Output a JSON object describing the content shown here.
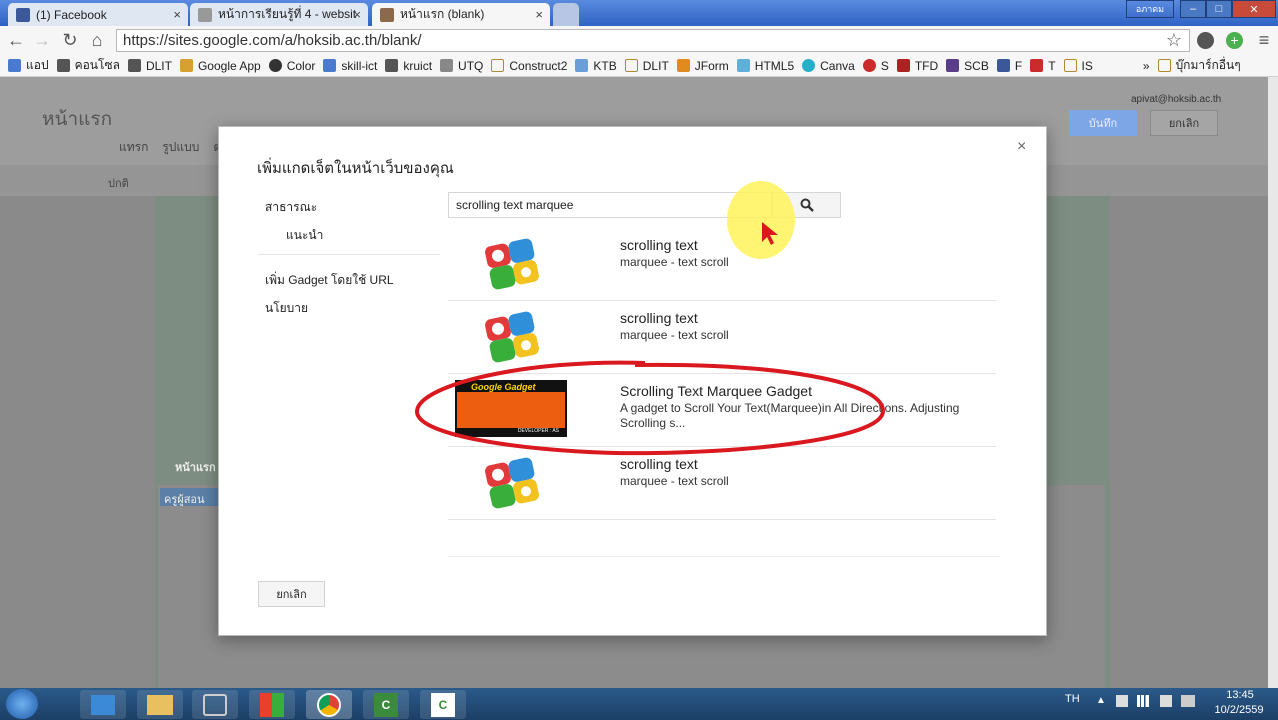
{
  "tabs": [
    {
      "title": "(1) Facebook"
    },
    {
      "title": "หน้าการเรียนรู้ที่ 4 - websit"
    },
    {
      "title": "หน้าแรก (blank)"
    }
  ],
  "window": {
    "user_label": "อภาดม"
  },
  "toolbar": {
    "url": "https://sites.google.com/a/hoksib.ac.th/blank/"
  },
  "bookmarks": [
    {
      "label": "แอป",
      "color": "#4a7bd0"
    },
    {
      "label": "คอนโซล",
      "color": "#555"
    },
    {
      "label": "DLIT",
      "color": "#555"
    },
    {
      "label": "Google App",
      "color": "#d8a030"
    },
    {
      "label": "Color",
      "color": "#333"
    },
    {
      "label": "skill-ict",
      "color": "#4a7bd0"
    },
    {
      "label": "kruict",
      "color": "#555"
    },
    {
      "label": "UTQ",
      "color": "#888"
    },
    {
      "label": "Construct2",
      "color": "#d6b25a"
    },
    {
      "label": "KTB",
      "color": "#6a9ed8"
    },
    {
      "label": "DLIT",
      "color": "#d6b25a"
    },
    {
      "label": "JForm",
      "color": "#e08a20"
    },
    {
      "label": "HTML5",
      "color": "#5fb0d8"
    },
    {
      "label": "Canva",
      "color": "#25b0c8"
    },
    {
      "label": "S",
      "color": "#cc2b2b"
    },
    {
      "label": "TFD",
      "color": "#aa2222"
    },
    {
      "label": "SCB",
      "color": "#5a3d8a"
    },
    {
      "label": "F",
      "color": "#3b5998"
    },
    {
      "label": "T",
      "color": "#cc2b2b"
    },
    {
      "label": "IS",
      "color": "#d6b25a"
    }
  ],
  "bookmarks_more": "»",
  "bookmarks_other": "บุ๊กมาร์กอื่นๆ",
  "site": {
    "page_title": "หน้าแรก",
    "menu": [
      "แทรก",
      "รูปแบบ",
      "ต"
    ],
    "font_label": "ปกติ",
    "account": "apivat@hoksib.ac.th",
    "save_label": "บันทึก",
    "cancel_label": "ยกเลิก",
    "bg_label_1": "หน้าแรก",
    "bg_label_2": "ครูผู้สอน"
  },
  "dialog": {
    "title": "เพิ่มแกดเจ็ตในหน้าเว็บของคุณ",
    "close": "×",
    "sidebar": {
      "public": "สาธารณะ",
      "recommended": "แนะนำ",
      "add_by_url": "เพิ่ม Gadget โดยใช้ URL",
      "policy": "นโยบาย"
    },
    "search_value": "scrolling text marquee",
    "results": [
      {
        "title": "scrolling text",
        "desc": "marquee - text scroll"
      },
      {
        "title": "scrolling text",
        "desc": "marquee - text scroll"
      },
      {
        "title": "Scrolling Text Marquee Gadget",
        "desc": "A gadget to Scroll Your Text(Marquee)in All Directions. Adjusting Scrolling s...",
        "thumb_text": "Google Gadget",
        "thumb_footer": "DEVELOPER : AS"
      },
      {
        "title": "scrolling text",
        "desc": "marquee - text scroll"
      }
    ],
    "cancel_label": "ยกเลิก"
  },
  "taskbar": {
    "lang": "TH",
    "time": "13:45",
    "date": "10/2/2559"
  },
  "colors": {
    "accent_blue": "#4d90fe",
    "annotation_red": "#d9181f",
    "cursor_highlight": "#fff35a"
  }
}
